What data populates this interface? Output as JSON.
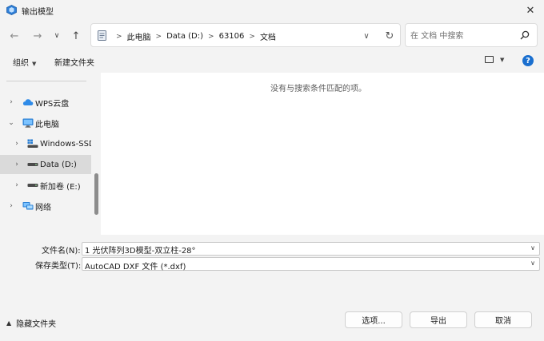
{
  "window": {
    "title": "输出模型"
  },
  "nav": {
    "breadcrumbs": [
      "此电脑",
      "Data (D:)",
      "63106",
      "文档"
    ],
    "search_placeholder": "在 文档 中搜索"
  },
  "toolbar": {
    "organize_label": "组织",
    "new_folder_label": "新建文件夹"
  },
  "tree": [
    {
      "label": "WPS云盘",
      "expand": "collapsed"
    },
    {
      "label": "此电脑",
      "expand": "expanded"
    },
    {
      "label": "Windows-SSD",
      "expand": "collapsed"
    },
    {
      "label": "Data (D:)",
      "expand": "collapsed",
      "selected": true
    },
    {
      "label": "新加卷 (E:)",
      "expand": "collapsed"
    },
    {
      "label": "网络",
      "expand": "collapsed"
    }
  ],
  "file_pane": {
    "empty_message": "没有与搜索条件匹配的项。"
  },
  "form": {
    "filename_label": "文件名(N):",
    "filename_value": "1 光伏阵列3D模型-双立柱-28°",
    "filetype_label": "保存类型(T):",
    "filetype_value": "AutoCAD DXF 文件 (*.dxf)"
  },
  "footer": {
    "hide_folders_label": "隐藏文件夹",
    "options_label": "选项...",
    "export_label": "导出",
    "cancel_label": "取消"
  },
  "colors": {
    "accent": "#1a6fcf",
    "selection": "#dadada",
    "background": "#f3f3f3"
  }
}
